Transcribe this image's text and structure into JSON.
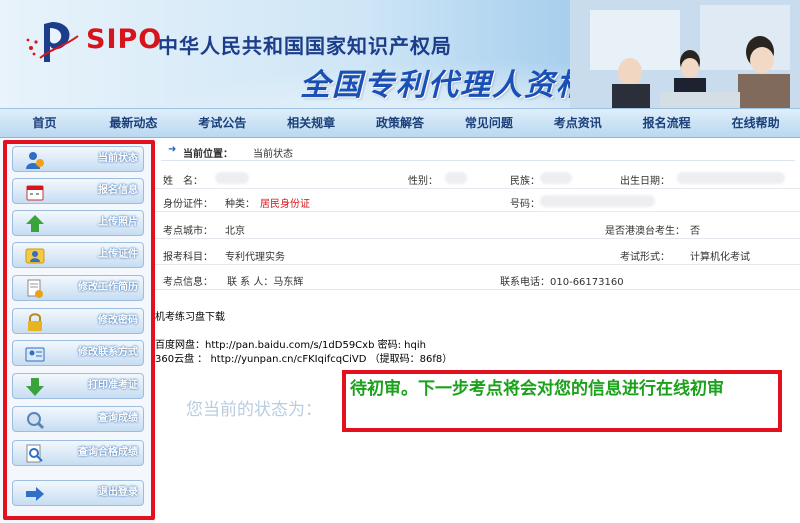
{
  "header": {
    "logo_text": "SIPO",
    "org_name": "中华人民共和国国家知识产权局",
    "exam_title": "全国专利代理人资格考试"
  },
  "nav": {
    "items": [
      "首页",
      "最新动态",
      "考试公告",
      "相关规章",
      "政策解答",
      "常见问题",
      "考点资讯",
      "报名流程",
      "在线帮助"
    ]
  },
  "sidebar": {
    "items": [
      {
        "label": "当前状态",
        "icon": "user-status-icon"
      },
      {
        "label": "报名信息",
        "icon": "calendar-icon"
      },
      {
        "label": "上传照片",
        "icon": "upload-arrow-icon"
      },
      {
        "label": "上传证件",
        "icon": "id-card-icon"
      },
      {
        "label": "修改工作简历",
        "icon": "document-gear-icon"
      },
      {
        "label": "修改密码",
        "icon": "lock-icon"
      },
      {
        "label": "修改联系方式",
        "icon": "contact-card-icon"
      },
      {
        "label": "打印准考证",
        "icon": "download-arrow-icon"
      },
      {
        "label": "查询成绩",
        "icon": "search-globe-icon"
      },
      {
        "label": "查询合格成绩",
        "icon": "magnifier-doc-icon"
      },
      {
        "label": "退出登录",
        "icon": "logout-arrow-icon"
      }
    ]
  },
  "breadcrumb": {
    "label": "当前位置：",
    "value": "当前状态"
  },
  "info": {
    "name_label": "姓　名：",
    "gender_label": "性别：",
    "ethnicity_label": "民族：",
    "birthdate_label": "出生日期：",
    "id_doc_label": "身份证件：",
    "id_type_label": "种类：",
    "id_type_value": "居民身份证",
    "id_number_label": "号码：",
    "exam_city_label": "考点城市：",
    "exam_city_value": "北京",
    "hk_macau_tw_label": "是否港澳台考生：",
    "hk_macau_tw_value": "否",
    "subject_label": "报考科目：",
    "subject_value": "专利代理实务",
    "exam_form_label": "考试形式：",
    "exam_form_value": "计算机化考试",
    "site_info_label": "考点信息：",
    "contact_person": "联 系 人：马东辉",
    "contact_phone": "联系电话：010-66173160"
  },
  "downloads": {
    "title": "机考练习盘下载",
    "baidu": "百度网盘：http://pan.baidu.com/s/1dD59Cxb 密码: hqih",
    "yun360": "360云盘 ： http://yunpan.cn/cFKIqifcqCiVD （提取码：86f8）"
  },
  "status": {
    "label": "您当前的状态为：",
    "value": "待初审。下一步考点将会对您的信息进行在线初审"
  },
  "colors": {
    "highlight_red": "#e3101e",
    "status_green": "#1ba11b",
    "nav_text": "#1c3f7a",
    "title_blue": "#1a4fb5"
  }
}
